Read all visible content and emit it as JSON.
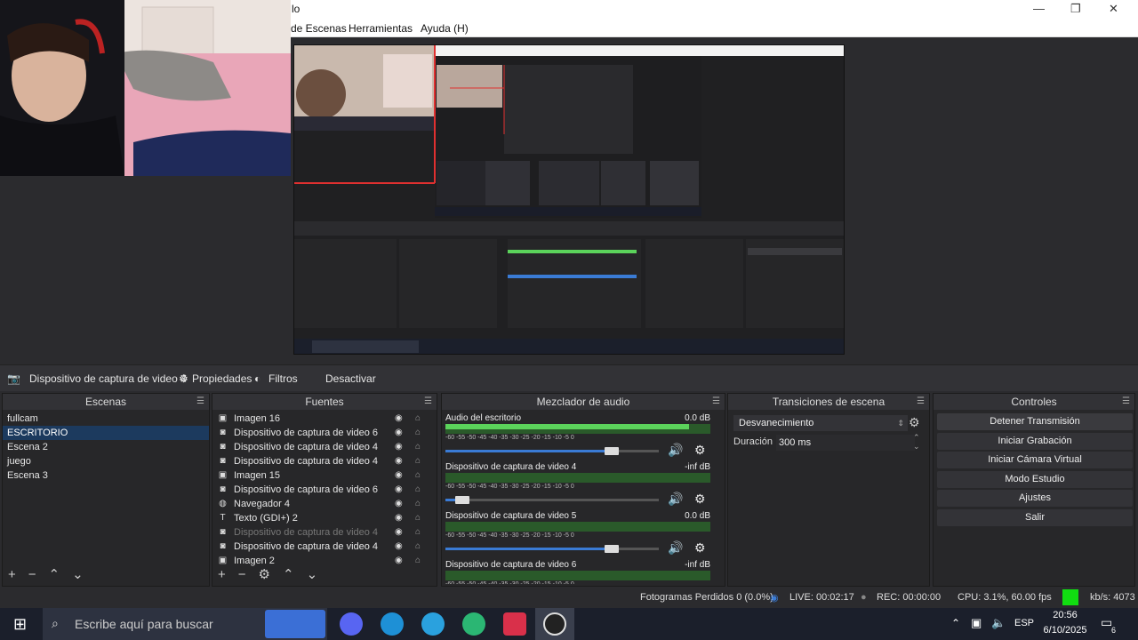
{
  "titlebar": {
    "title_fragment": "lo",
    "minimize": "—",
    "maximize": "❐",
    "close": "✕"
  },
  "menu": {
    "items": [
      "de Escenas",
      "Herramientas",
      "Ayuda (H)"
    ]
  },
  "source_bar": {
    "selected_source": "Dispositivo de captura de video 4",
    "properties": "Propiedades",
    "filters": "Filtros",
    "deactivate": "Desactivar"
  },
  "scenes": {
    "title": "Escenas",
    "items": [
      "fullcam",
      "ESCRITORIO",
      "Escena 2",
      "juego",
      "Escena 3"
    ],
    "selected_index": 1
  },
  "sources": {
    "title": "Fuentes",
    "items": [
      {
        "name": "Imagen 16",
        "icon": "image-icon",
        "dim": false
      },
      {
        "name": "Dispositivo de captura de video 6",
        "icon": "camera-icon",
        "dim": false
      },
      {
        "name": "Dispositivo de captura de video 4",
        "icon": "camera-icon",
        "dim": false
      },
      {
        "name": "Dispositivo de captura de video 4",
        "icon": "camera-icon",
        "dim": false
      },
      {
        "name": "Imagen 15",
        "icon": "image-icon",
        "dim": false
      },
      {
        "name": "Dispositivo de captura de video 6",
        "icon": "camera-icon",
        "dim": false
      },
      {
        "name": "Navegador 4",
        "icon": "globe-icon",
        "dim": false
      },
      {
        "name": "Texto (GDI+) 2",
        "icon": "text-icon",
        "dim": false
      },
      {
        "name": "Dispositivo de captura de video 4",
        "icon": "camera-icon",
        "dim": true
      },
      {
        "name": "Dispositivo de captura de video 4",
        "icon": "camera-icon",
        "dim": false
      },
      {
        "name": "Imagen 2",
        "icon": "image-icon",
        "dim": false
      }
    ]
  },
  "mixer": {
    "title": "Mezclador de audio",
    "ticks": "-60  -55  -50  -45  -40  -35  -30  -25  -20  -15  -10  -5  0",
    "channels": [
      {
        "name": "Audio del escritorio",
        "db": "0.0 dB",
        "level": 0.92,
        "volume": 0.8
      },
      {
        "name": "Dispositivo de captura de video 4",
        "db": "-inf dB",
        "level": 0.0,
        "volume": 0.05
      },
      {
        "name": "Dispositivo de captura de video 5",
        "db": "0.0 dB",
        "level": 0.0,
        "volume": 0.8
      },
      {
        "name": "Dispositivo de captura de video 6",
        "db": "-inf dB",
        "level": 0.0,
        "volume": 0.05
      }
    ]
  },
  "transitions": {
    "title": "Transiciones de escena",
    "selected": "Desvanecimiento",
    "duration_label": "Duración",
    "duration_value": "300 ms"
  },
  "controls": {
    "title": "Controles",
    "buttons": [
      "Detener Transmisión",
      "Iniciar Grabación",
      "Iniciar Cámara Virtual",
      "Modo Estudio",
      "Ajustes",
      "Salir"
    ]
  },
  "status": {
    "dropped": "Fotogramas Perdidos 0 (0.0%)",
    "live": "LIVE: 00:02:17",
    "rec": "REC: 00:00:00",
    "cpu": "CPU: 3.1%, 60.00 fps",
    "kbps": "kb/s: 4073"
  },
  "taskbar": {
    "search_placeholder": "Escribe aquí para buscar",
    "lang": "ESP",
    "time": "20:56",
    "date": "6/10/2025",
    "notif_count": "6"
  }
}
